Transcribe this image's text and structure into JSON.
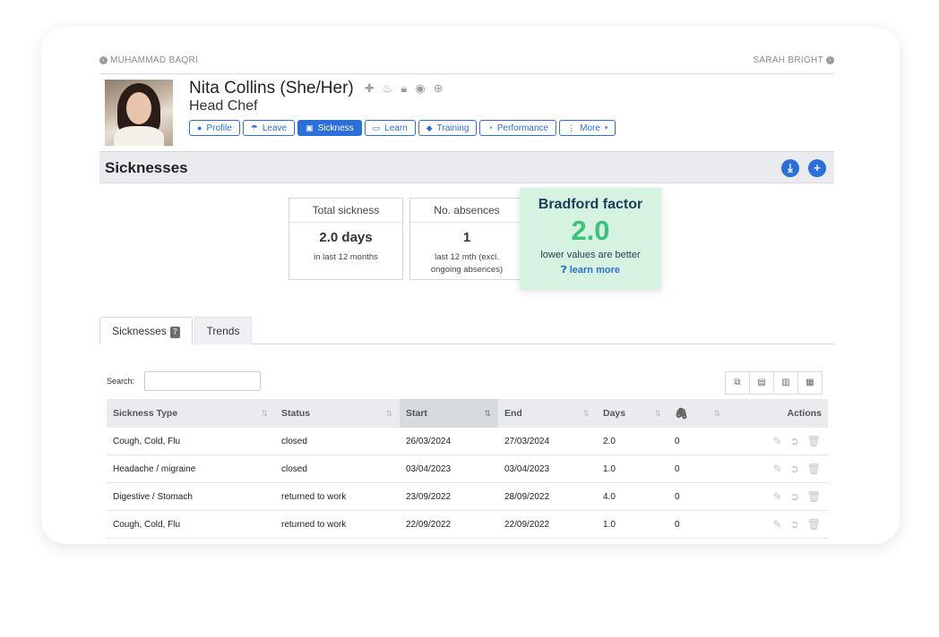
{
  "nav": {
    "prev": "MUHAMMAD BAQRI",
    "next": "SARAH BRIGHT"
  },
  "profile": {
    "name": "Nita Collins (She/Her)",
    "role": "Head Chef",
    "icons": [
      "first-aid-icon",
      "fire-icon",
      "lock-icon",
      "eye-icon",
      "lifebuoy-icon"
    ]
  },
  "tabs": [
    {
      "label": "Profile",
      "icon": "user-icon"
    },
    {
      "label": "Leave",
      "icon": "umbrella-icon"
    },
    {
      "label": "Sickness",
      "icon": "medkit-icon",
      "active": true
    },
    {
      "label": "Learn",
      "icon": "laptop-icon"
    },
    {
      "label": "Training",
      "icon": "graduation-cap-icon"
    },
    {
      "label": "Performance",
      "icon": "gauge-icon"
    },
    {
      "label": "More",
      "icon": "ellipsis-icon"
    }
  ],
  "section": {
    "title": "Sicknesses"
  },
  "stats": {
    "total": {
      "header": "Total sickness",
      "value": "2.0 days",
      "sub": "in last 12 months"
    },
    "absences": {
      "header": "No. absences",
      "value": "1",
      "sub1": "last 12 mth (excl.",
      "sub2": "ongoing absences)"
    }
  },
  "bradford": {
    "title": "Bradford factor",
    "value": "2.0",
    "sub": "lower values are better",
    "link": "learn more"
  },
  "list_tabs": {
    "sicknesses": "Sicknesses",
    "count": "7",
    "trends": "Trends"
  },
  "search": {
    "label": "Search:",
    "value": ""
  },
  "table": {
    "headers": {
      "type": "Sickness Type",
      "status": "Status",
      "start": "Start",
      "end": "End",
      "days": "Days",
      "actions": "Actions"
    },
    "rows": [
      {
        "type": "Cough, Cold, Flu",
        "status": "closed",
        "start": "26/03/2024",
        "end": "27/03/2024",
        "days": "2.0",
        "att": "0"
      },
      {
        "type": "Headache / migraine",
        "status": "closed",
        "start": "03/04/2023",
        "end": "03/04/2023",
        "days": "1.0",
        "att": "0"
      },
      {
        "type": "Digestive / Stomach",
        "status": "returned to work",
        "start": "23/09/2022",
        "end": "28/09/2022",
        "days": "4.0",
        "att": "0"
      },
      {
        "type": "Cough, Cold, Flu",
        "status": "returned to work",
        "start": "22/09/2022",
        "end": "22/09/2022",
        "days": "1.0",
        "att": "0"
      }
    ]
  },
  "colors": {
    "accent": "#2c6fd6",
    "bradford_bg": "#d6f3e1",
    "bradford_value": "#3cc27a"
  }
}
